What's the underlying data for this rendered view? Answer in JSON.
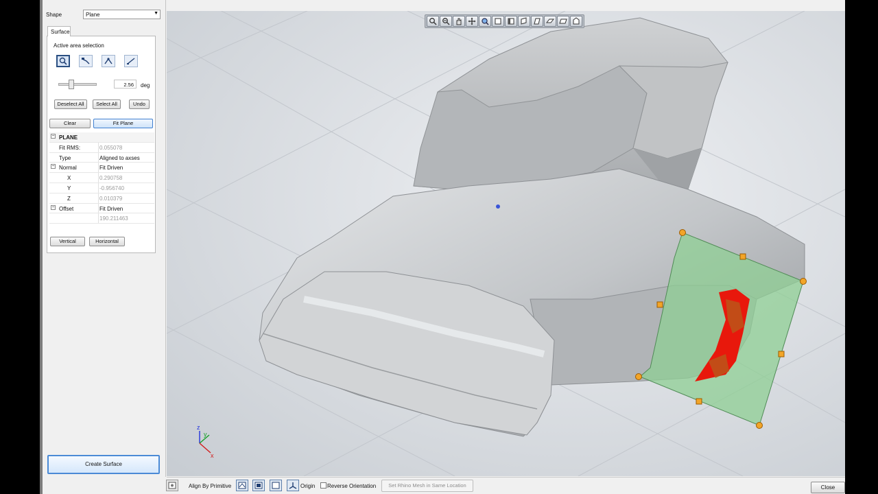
{
  "left_panel": {
    "shape_label": "Shape",
    "shape_value": "Plane",
    "surface_tab": "Surface",
    "active_area_label": "Active area selection",
    "angle_value": "2.56",
    "angle_unit": "deg",
    "deselect_all": "Deselect All",
    "select_all": "Select All",
    "undo": "Undo",
    "clear": "Clear",
    "fit_plane": "Fit Plane",
    "vertical": "Vertical",
    "horizontal": "Horizontal",
    "create_surface": "Create Surface"
  },
  "properties": {
    "group": "PLANE",
    "fit_rms_label": "Fit RMS:",
    "fit_rms_value": "0.055078",
    "type_label": "Type",
    "type_value": "Aligned to axses",
    "normal_label": "Normal",
    "normal_value": "Fit Driven",
    "x_label": "X",
    "x_value": "0.290758",
    "y_label": "Y",
    "y_value": "-0.956740",
    "z_label": "Z",
    "z_value": "0.010379",
    "offset_label": "Offset",
    "offset_value": "Fit Driven",
    "offset_number": "190.211463"
  },
  "viewport": {
    "axis_z": "z",
    "axis_y": "y",
    "axis_x": "x",
    "colors": {
      "mesh": "#b9bcbf",
      "plane": "#8fcf94",
      "deviation": "#e8180c",
      "handle": "#f0a020"
    }
  },
  "bottom_bar": {
    "align_by_primitive": "Align By Primitive",
    "origin": "Origin",
    "reverse_orientation": "Reverse Orientation",
    "set_rhino_mesh": "Set Rhino Mesh in Same Location",
    "close": "Close"
  }
}
